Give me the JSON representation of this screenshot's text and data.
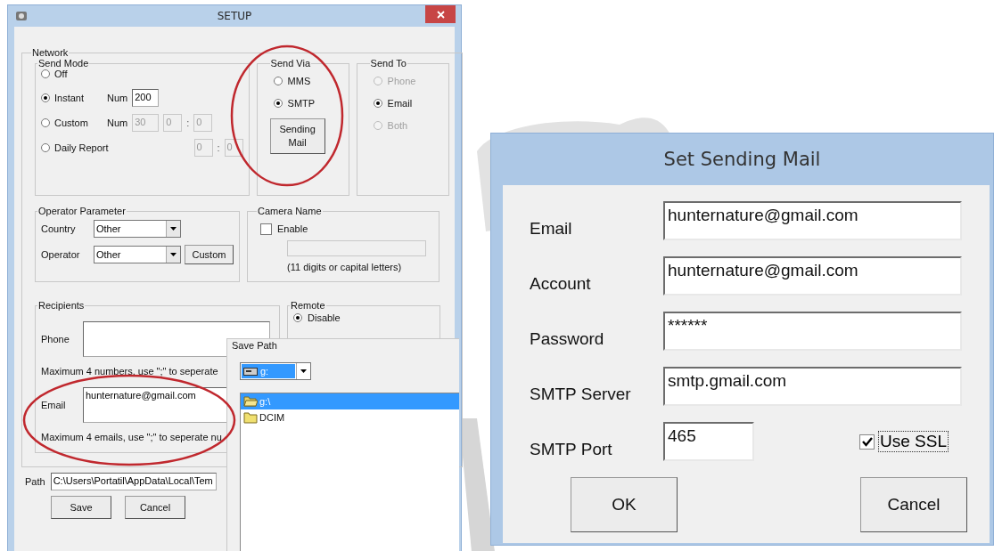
{
  "setup_window": {
    "title": "SETUP",
    "network": {
      "label": "Network",
      "send_mode": {
        "label": "Send Mode",
        "options": [
          {
            "label": "Off",
            "selected": false
          },
          {
            "label": "Instant",
            "selected": true,
            "num_label": "Num",
            "num": "200",
            "fields_disabled": false
          },
          {
            "label": "Custom",
            "selected": false,
            "num_label": "Num",
            "num": "30",
            "hour": "0",
            "separator": ":",
            "minute": "0",
            "fields_disabled": true
          },
          {
            "label": "Daily Report",
            "selected": false,
            "hour": "0",
            "separator": ":",
            "minute": "0",
            "fields_disabled": true
          }
        ]
      },
      "send_via": {
        "label": "Send Via",
        "options": [
          {
            "label": "MMS",
            "selected": false
          },
          {
            "label": "SMTP",
            "selected": true
          }
        ],
        "button": "Sending Mail"
      },
      "send_to": {
        "label": "Send To",
        "options": [
          {
            "label": "Phone",
            "selected": false,
            "disabled": true
          },
          {
            "label": "Email",
            "selected": true,
            "disabled": false
          },
          {
            "label": "Both",
            "selected": false,
            "disabled": true
          }
        ]
      },
      "operator_parameter": {
        "label": "Operator Parameter",
        "fields": [
          {
            "label": "Country",
            "value": "Other"
          },
          {
            "label": "Operator",
            "value": "Other"
          }
        ],
        "button": "Custom"
      },
      "camera_name": {
        "label": "Camera Name",
        "enable": {
          "label": "Enable",
          "checked": false
        },
        "hint": "(11 digits or capital letters)"
      },
      "recipients": {
        "label": "Recipients",
        "phone": {
          "label": "Phone",
          "hint": "Maximum 4 numbers, use \";\" to seperate"
        },
        "email": {
          "label": "Email",
          "value": "hunternature@gmail.com",
          "hint": "Maximum 4 emails, use \";\" to seperate nu"
        }
      },
      "remote": {
        "label": "Remote",
        "options": [
          {
            "label": "Disable",
            "selected": true
          }
        ]
      }
    },
    "path": {
      "label": "Path",
      "value": "C:\\Users\\Portatil\\AppData\\Local\\Tem"
    },
    "buttons": [
      "Save",
      "Cancel"
    ]
  },
  "save_path": {
    "label": "Save Path",
    "drive": "g:",
    "folders": [
      {
        "name": "g:\\",
        "selected": true,
        "kind": "open"
      },
      {
        "name": "DCIM",
        "selected": false,
        "kind": "closed"
      }
    ]
  },
  "sending_mail_window": {
    "title": "Set Sending Mail",
    "fields": [
      {
        "label": "Email",
        "value": "hunternature@gmail.com"
      },
      {
        "label": "Account",
        "value": "hunternature@gmail.com"
      },
      {
        "label": "Password",
        "value": "******"
      },
      {
        "label": "SMTP Server",
        "value": "smtp.gmail.com"
      }
    ],
    "port": {
      "label": "SMTP Port",
      "value": "465"
    },
    "use_ssl": {
      "label": "Use SSL",
      "checked": true
    },
    "buttons": [
      "OK",
      "Cancel"
    ]
  }
}
